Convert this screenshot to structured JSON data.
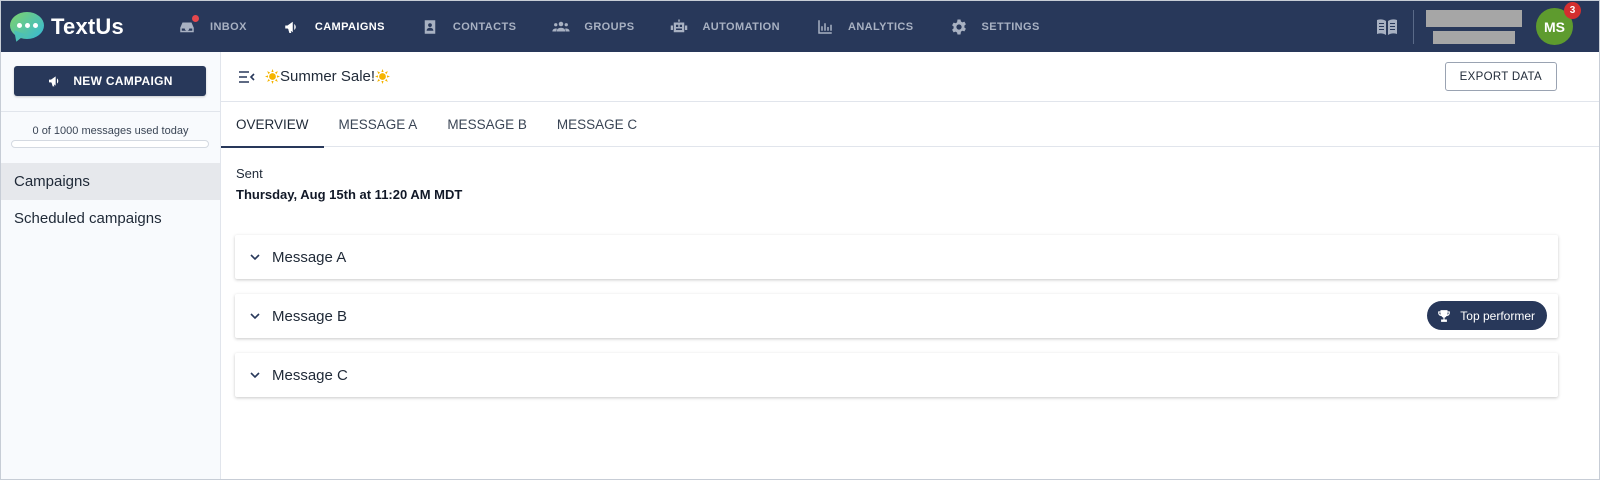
{
  "app": {
    "name": "TextUs"
  },
  "nav": {
    "items": [
      {
        "label": "INBOX",
        "icon": "inbox-icon",
        "active": false,
        "has_dot": true
      },
      {
        "label": "CAMPAIGNS",
        "icon": "megaphone-icon",
        "active": true
      },
      {
        "label": "CONTACTS",
        "icon": "contact-card-icon",
        "active": false
      },
      {
        "label": "GROUPS",
        "icon": "people-icon",
        "active": false
      },
      {
        "label": "AUTOMATION",
        "icon": "robot-icon",
        "active": false
      },
      {
        "label": "ANALYTICS",
        "icon": "bar-chart-icon",
        "active": false
      },
      {
        "label": "SETTINGS",
        "icon": "gear-icon",
        "active": false
      }
    ]
  },
  "user": {
    "initials": "MS",
    "notifications": "3"
  },
  "sidebar": {
    "new_campaign_label": "NEW CAMPAIGN",
    "usage_text": "0 of 1000 messages used today",
    "usage_fraction": 0,
    "items": [
      {
        "label": "Campaigns",
        "active": true
      },
      {
        "label": "Scheduled campaigns",
        "active": false
      }
    ]
  },
  "campaign": {
    "title": "Summer Sale!",
    "export_label": "EXPORT DATA",
    "tabs": [
      {
        "label": "OVERVIEW",
        "active": true
      },
      {
        "label": "MESSAGE A",
        "active": false
      },
      {
        "label": "MESSAGE B",
        "active": false
      },
      {
        "label": "MESSAGE C",
        "active": false
      }
    ],
    "sent_label": "Sent",
    "sent_date": "Thursday, Aug 15th at 11:20 AM MDT",
    "messages": [
      {
        "label": "Message A",
        "top_performer": false
      },
      {
        "label": "Message B",
        "top_performer": true
      },
      {
        "label": "Message C",
        "top_performer": false
      }
    ],
    "top_performer_label": "Top performer"
  },
  "colors": {
    "nav_bg": "#28385a",
    "accent": "#28385a",
    "avatar_bg": "#5e9b2e",
    "badge_red": "#d32f2f"
  }
}
